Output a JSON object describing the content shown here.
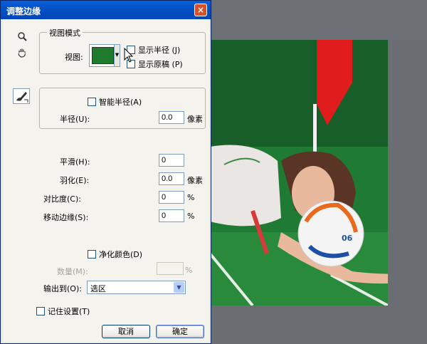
{
  "dialog": {
    "title": "调整边缘",
    "close_label": "×"
  },
  "tools": {
    "zoom_icon": "magnifier-icon",
    "hand_icon": "hand-icon",
    "brush_icon": "refine-brush-icon"
  },
  "view_mode": {
    "legend": "视图模式",
    "view_label": "视图:",
    "show_radius_label": "显示半径 (J)",
    "show_original_label": "显示原稿 (P)"
  },
  "edge_detection": {
    "smart_radius_label": "智能半径(A)",
    "radius_label": "半径(U):",
    "radius_value": "0.0",
    "radius_unit": "像素"
  },
  "adjust_edge": {
    "smooth_label": "平滑(H):",
    "smooth_value": "0",
    "feather_label": "羽化(E):",
    "feather_value": "0.0",
    "feather_unit": "像素",
    "contrast_label": "对比度(C):",
    "contrast_value": "0",
    "contrast_unit": "%",
    "shift_label": "移动边缘(S):",
    "shift_value": "0",
    "shift_unit": "%"
  },
  "output": {
    "decontaminate_label": "净化颜色(D)",
    "amount_label": "数量(M):",
    "amount_unit": "%",
    "output_to_label": "输出到(O):",
    "output_to_value": "选区"
  },
  "remember_label": "记住设置(T)",
  "buttons": {
    "cancel": "取消",
    "ok": "确定"
  },
  "photo": {
    "ball_text": "06"
  }
}
